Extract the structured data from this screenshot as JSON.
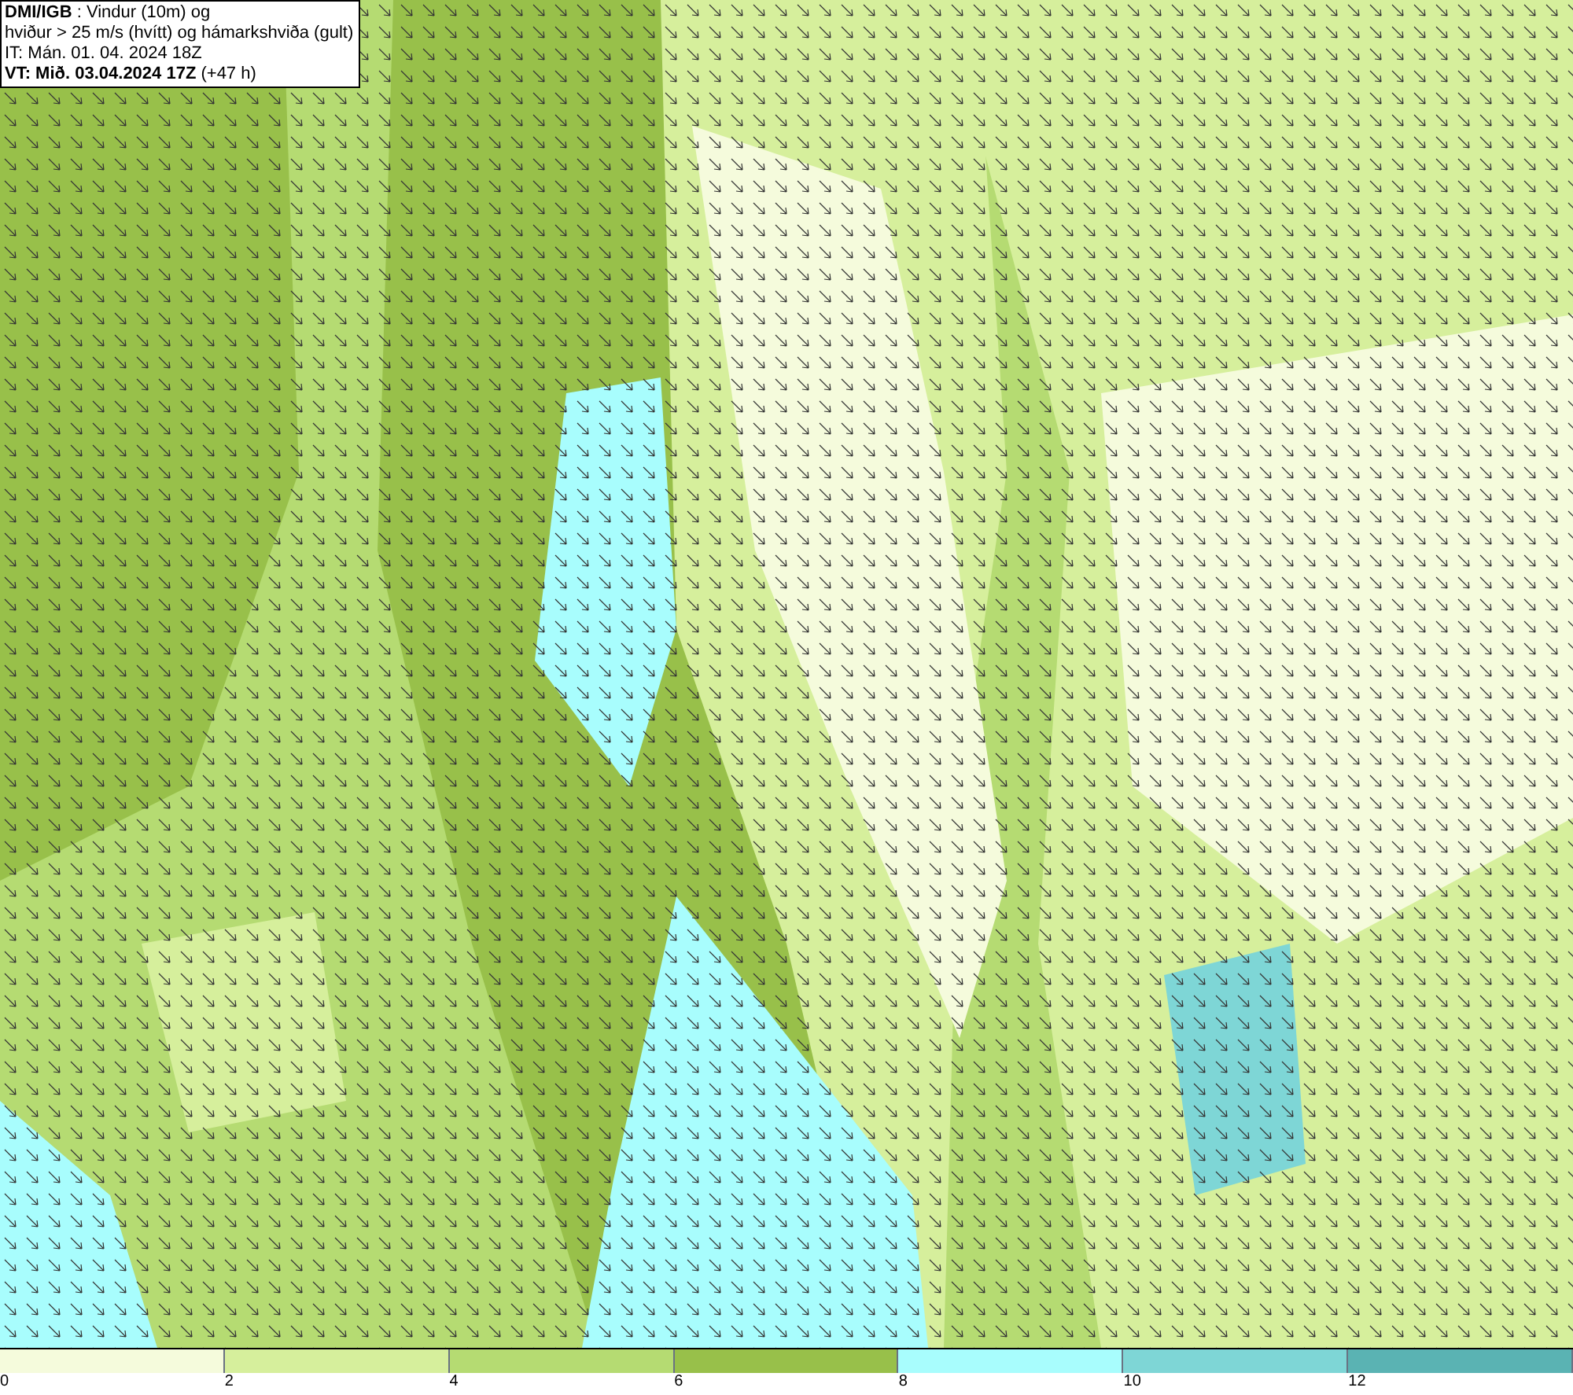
{
  "legend": {
    "lines": [
      "**DMI/IGB** : Vindur (10m) og",
      "hviður > 25 m/s (hvítt) og hámarkshviða (gult)",
      "IT: Mán. 01. 04. 2024 18Z",
      "**VT: Mið. 03.04.2024 17Z** (+47 h)"
    ]
  },
  "color_bar": [
    {
      "label": "0",
      "color": "#f5fbdc"
    },
    {
      "label": "2",
      "color": "#d6ef9c"
    },
    {
      "label": "4",
      "color": "#b5db72"
    },
    {
      "label": "6",
      "color": "#98c04a"
    },
    {
      "label": "8",
      "color": "#a8fdfd"
    },
    {
      "label": "10",
      "color": "#7ed6d6"
    },
    {
      "label": "12",
      "color": "#5ab3b3"
    }
  ]
}
